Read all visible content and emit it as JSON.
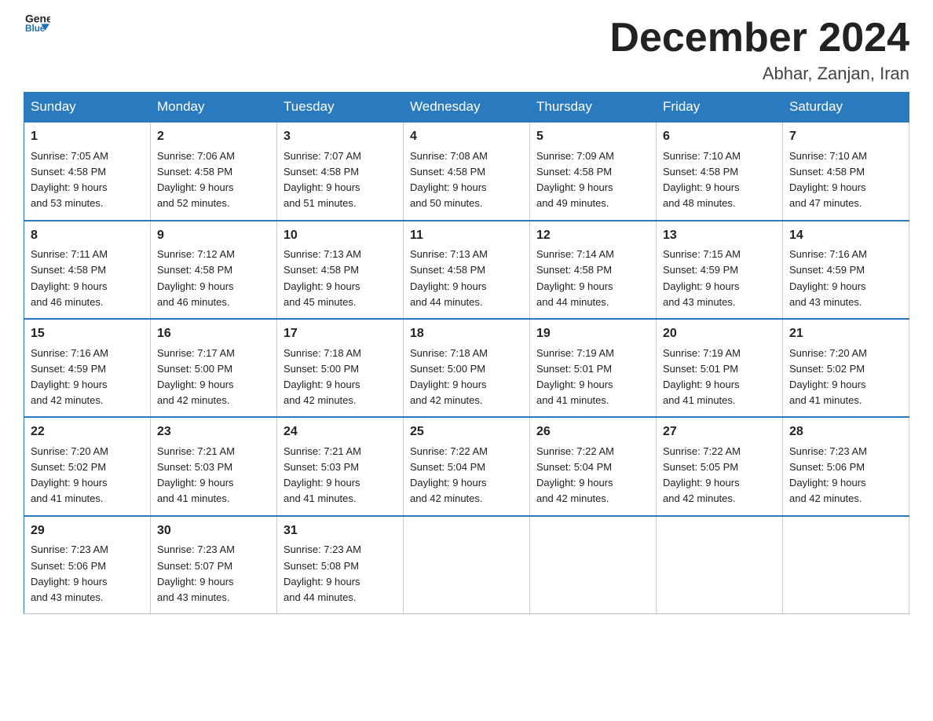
{
  "header": {
    "logo_line1": "General",
    "logo_line2": "Blue",
    "month_title": "December 2024",
    "location": "Abhar, Zanjan, Iran"
  },
  "days_of_week": [
    "Sunday",
    "Monday",
    "Tuesday",
    "Wednesday",
    "Thursday",
    "Friday",
    "Saturday"
  ],
  "weeks": [
    [
      {
        "num": "1",
        "sunrise": "Sunrise: 7:05 AM",
        "sunset": "Sunset: 4:58 PM",
        "daylight": "Daylight: 9 hours",
        "minutes": "and 53 minutes."
      },
      {
        "num": "2",
        "sunrise": "Sunrise: 7:06 AM",
        "sunset": "Sunset: 4:58 PM",
        "daylight": "Daylight: 9 hours",
        "minutes": "and 52 minutes."
      },
      {
        "num": "3",
        "sunrise": "Sunrise: 7:07 AM",
        "sunset": "Sunset: 4:58 PM",
        "daylight": "Daylight: 9 hours",
        "minutes": "and 51 minutes."
      },
      {
        "num": "4",
        "sunrise": "Sunrise: 7:08 AM",
        "sunset": "Sunset: 4:58 PM",
        "daylight": "Daylight: 9 hours",
        "minutes": "and 50 minutes."
      },
      {
        "num": "5",
        "sunrise": "Sunrise: 7:09 AM",
        "sunset": "Sunset: 4:58 PM",
        "daylight": "Daylight: 9 hours",
        "minutes": "and 49 minutes."
      },
      {
        "num": "6",
        "sunrise": "Sunrise: 7:10 AM",
        "sunset": "Sunset: 4:58 PM",
        "daylight": "Daylight: 9 hours",
        "minutes": "and 48 minutes."
      },
      {
        "num": "7",
        "sunrise": "Sunrise: 7:10 AM",
        "sunset": "Sunset: 4:58 PM",
        "daylight": "Daylight: 9 hours",
        "minutes": "and 47 minutes."
      }
    ],
    [
      {
        "num": "8",
        "sunrise": "Sunrise: 7:11 AM",
        "sunset": "Sunset: 4:58 PM",
        "daylight": "Daylight: 9 hours",
        "minutes": "and 46 minutes."
      },
      {
        "num": "9",
        "sunrise": "Sunrise: 7:12 AM",
        "sunset": "Sunset: 4:58 PM",
        "daylight": "Daylight: 9 hours",
        "minutes": "and 46 minutes."
      },
      {
        "num": "10",
        "sunrise": "Sunrise: 7:13 AM",
        "sunset": "Sunset: 4:58 PM",
        "daylight": "Daylight: 9 hours",
        "minutes": "and 45 minutes."
      },
      {
        "num": "11",
        "sunrise": "Sunrise: 7:13 AM",
        "sunset": "Sunset: 4:58 PM",
        "daylight": "Daylight: 9 hours",
        "minutes": "and 44 minutes."
      },
      {
        "num": "12",
        "sunrise": "Sunrise: 7:14 AM",
        "sunset": "Sunset: 4:58 PM",
        "daylight": "Daylight: 9 hours",
        "minutes": "and 44 minutes."
      },
      {
        "num": "13",
        "sunrise": "Sunrise: 7:15 AM",
        "sunset": "Sunset: 4:59 PM",
        "daylight": "Daylight: 9 hours",
        "minutes": "and 43 minutes."
      },
      {
        "num": "14",
        "sunrise": "Sunrise: 7:16 AM",
        "sunset": "Sunset: 4:59 PM",
        "daylight": "Daylight: 9 hours",
        "minutes": "and 43 minutes."
      }
    ],
    [
      {
        "num": "15",
        "sunrise": "Sunrise: 7:16 AM",
        "sunset": "Sunset: 4:59 PM",
        "daylight": "Daylight: 9 hours",
        "minutes": "and 42 minutes."
      },
      {
        "num": "16",
        "sunrise": "Sunrise: 7:17 AM",
        "sunset": "Sunset: 5:00 PM",
        "daylight": "Daylight: 9 hours",
        "minutes": "and 42 minutes."
      },
      {
        "num": "17",
        "sunrise": "Sunrise: 7:18 AM",
        "sunset": "Sunset: 5:00 PM",
        "daylight": "Daylight: 9 hours",
        "minutes": "and 42 minutes."
      },
      {
        "num": "18",
        "sunrise": "Sunrise: 7:18 AM",
        "sunset": "Sunset: 5:00 PM",
        "daylight": "Daylight: 9 hours",
        "minutes": "and 42 minutes."
      },
      {
        "num": "19",
        "sunrise": "Sunrise: 7:19 AM",
        "sunset": "Sunset: 5:01 PM",
        "daylight": "Daylight: 9 hours",
        "minutes": "and 41 minutes."
      },
      {
        "num": "20",
        "sunrise": "Sunrise: 7:19 AM",
        "sunset": "Sunset: 5:01 PM",
        "daylight": "Daylight: 9 hours",
        "minutes": "and 41 minutes."
      },
      {
        "num": "21",
        "sunrise": "Sunrise: 7:20 AM",
        "sunset": "Sunset: 5:02 PM",
        "daylight": "Daylight: 9 hours",
        "minutes": "and 41 minutes."
      }
    ],
    [
      {
        "num": "22",
        "sunrise": "Sunrise: 7:20 AM",
        "sunset": "Sunset: 5:02 PM",
        "daylight": "Daylight: 9 hours",
        "minutes": "and 41 minutes."
      },
      {
        "num": "23",
        "sunrise": "Sunrise: 7:21 AM",
        "sunset": "Sunset: 5:03 PM",
        "daylight": "Daylight: 9 hours",
        "minutes": "and 41 minutes."
      },
      {
        "num": "24",
        "sunrise": "Sunrise: 7:21 AM",
        "sunset": "Sunset: 5:03 PM",
        "daylight": "Daylight: 9 hours",
        "minutes": "and 41 minutes."
      },
      {
        "num": "25",
        "sunrise": "Sunrise: 7:22 AM",
        "sunset": "Sunset: 5:04 PM",
        "daylight": "Daylight: 9 hours",
        "minutes": "and 42 minutes."
      },
      {
        "num": "26",
        "sunrise": "Sunrise: 7:22 AM",
        "sunset": "Sunset: 5:04 PM",
        "daylight": "Daylight: 9 hours",
        "minutes": "and 42 minutes."
      },
      {
        "num": "27",
        "sunrise": "Sunrise: 7:22 AM",
        "sunset": "Sunset: 5:05 PM",
        "daylight": "Daylight: 9 hours",
        "minutes": "and 42 minutes."
      },
      {
        "num": "28",
        "sunrise": "Sunrise: 7:23 AM",
        "sunset": "Sunset: 5:06 PM",
        "daylight": "Daylight: 9 hours",
        "minutes": "and 42 minutes."
      }
    ],
    [
      {
        "num": "29",
        "sunrise": "Sunrise: 7:23 AM",
        "sunset": "Sunset: 5:06 PM",
        "daylight": "Daylight: 9 hours",
        "minutes": "and 43 minutes."
      },
      {
        "num": "30",
        "sunrise": "Sunrise: 7:23 AM",
        "sunset": "Sunset: 5:07 PM",
        "daylight": "Daylight: 9 hours",
        "minutes": "and 43 minutes."
      },
      {
        "num": "31",
        "sunrise": "Sunrise: 7:23 AM",
        "sunset": "Sunset: 5:08 PM",
        "daylight": "Daylight: 9 hours",
        "minutes": "and 44 minutes."
      },
      null,
      null,
      null,
      null
    ]
  ]
}
